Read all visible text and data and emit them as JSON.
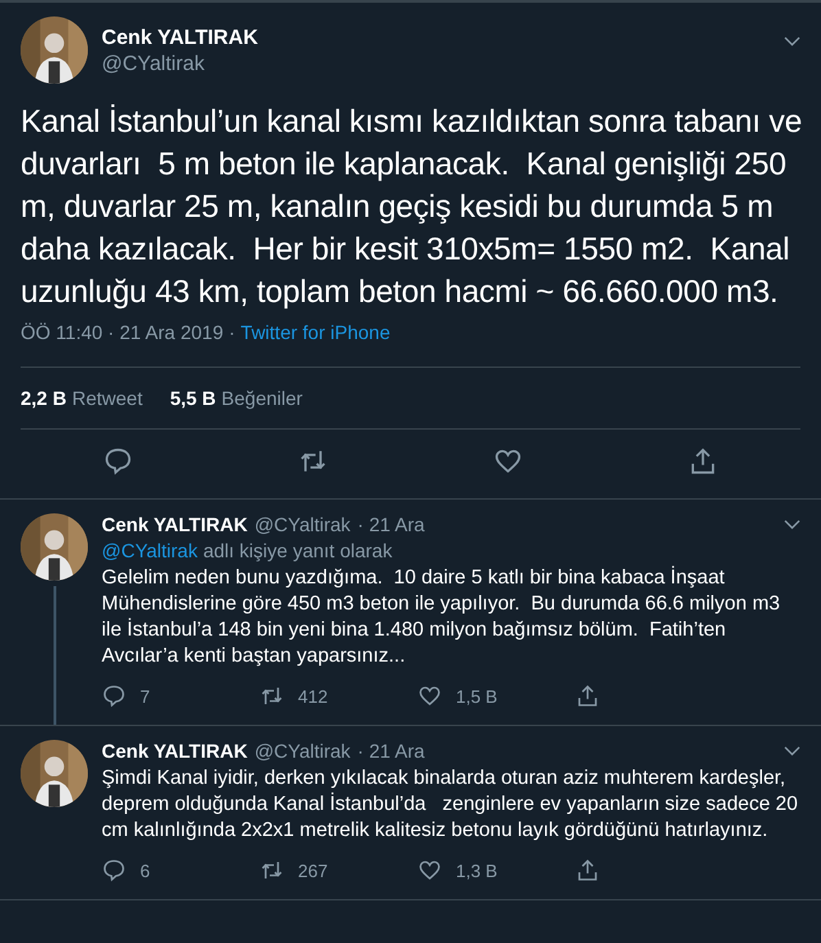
{
  "main_tweet": {
    "name": "Cenk YALTIRAK",
    "handle": "@CYaltirak",
    "text": "Kanal İstanbul’un kanal kısmı kazıldıktan sonra tabanı ve duvarları  5 m beton ile kaplanacak.  Kanal genişliği 250 m, duvarlar 25 m, kanalın geçiş kesidi bu durumda 5 m daha kazılacak.  Her bir kesit 310x5m= 1550 m2.  Kanal uzunluğu 43 km, toplam beton hacmi ~ 66.660.000 m3.",
    "time": "ÖÖ 11:40 · 21 Ara 2019",
    "separator": "·",
    "source": "Twitter for iPhone",
    "stats": [
      {
        "count": "2,2 B",
        "label": "Retweet"
      },
      {
        "count": "5,5 B",
        "label": "Beğeniler"
      }
    ]
  },
  "replies": [
    {
      "name": "Cenk YALTIRAK",
      "handle": "@CYaltirak",
      "date": "· 21 Ara",
      "reply_to": "@CYaltirak",
      "reply_suffix": "adlı kişiye yanıt olarak",
      "text": "Gelelim neden bunu yazdığıma.  10 daire 5 katlı bir bina kabaca İnşaat Mühendislerine göre 450 m3 beton ile yapılıyor.  Bu durumda 66.6 milyon m3 ile İstanbul’a 148 bin yeni bina 1.480 milyon bağımsız bölüm.  Fatih’ten Avcılar’a kenti baştan yaparsınız...",
      "replies": "7",
      "retweets": "412",
      "likes": "1,5 B",
      "thread_below": true
    },
    {
      "name": "Cenk YALTIRAK",
      "handle": "@CYaltirak",
      "date": "· 21 Ara",
      "text": "Şimdi Kanal iyidir, derken yıkılacak binalarda oturan aziz muhterem kardeşler, deprem olduğunda Kanal İstanbul’da   zenginlere ev yapanların size sadece 20 cm kalınlığında 2x2x1 metrelik kalitesiz betonu layık gördüğünü hatırlayınız.",
      "replies": "6",
      "retweets": "267",
      "likes": "1,3 B",
      "thread_below": false
    }
  ]
}
